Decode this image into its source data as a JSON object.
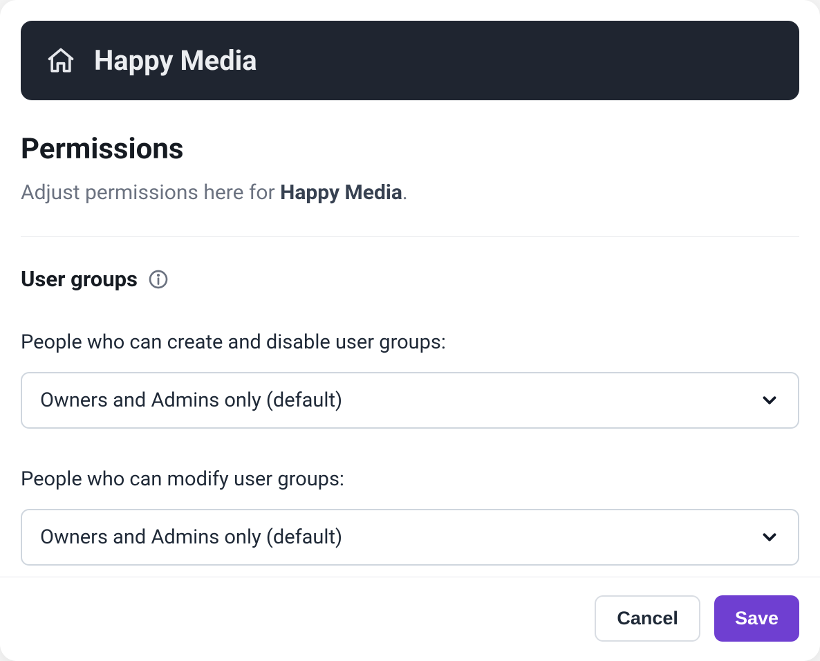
{
  "header": {
    "org_name": "Happy Media"
  },
  "page": {
    "title": "Permissions",
    "subtitle_prefix": "Adjust permissions here for ",
    "subtitle_bold": "Happy Media",
    "subtitle_suffix": "."
  },
  "user_groups": {
    "section_title": "User groups",
    "fields": [
      {
        "label": "People who can create and disable user groups:",
        "value": "Owners and Admins only (default)"
      },
      {
        "label": "People who can modify user groups:",
        "value": "Owners and Admins only (default)"
      }
    ]
  },
  "footer": {
    "cancel_label": "Cancel",
    "save_label": "Save"
  },
  "colors": {
    "header_bg": "#1f2530",
    "primary": "#6f3fd1",
    "text_muted": "#6b7280"
  }
}
